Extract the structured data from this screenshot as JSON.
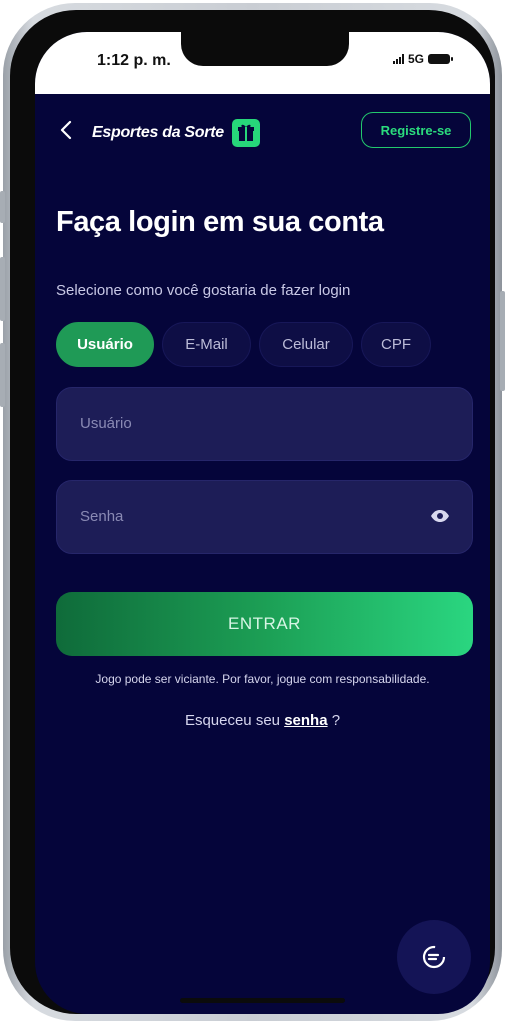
{
  "status_bar": {
    "time": "1:12 p. m.",
    "network": "5G"
  },
  "header": {
    "brand": "Esportes da Sorte",
    "register_label": "Registre-se",
    "back_icon": "chevron-left-icon",
    "gift_icon": "gift-icon"
  },
  "login": {
    "title": "Faça login em sua conta",
    "subtitle": "Selecione como você gostaria de fazer login",
    "tabs": [
      {
        "label": "Usuário",
        "active": true
      },
      {
        "label": "E-Mail",
        "active": false
      },
      {
        "label": "Celular",
        "active": false
      },
      {
        "label": "CPF",
        "active": false
      }
    ],
    "username_placeholder": "Usuário",
    "password_placeholder": "Senha",
    "enter_label": "ENTRAR",
    "disclaimer": "Jogo pode ser viciante. Por favor, jogue com responsabilidade.",
    "forgot_prefix": "Esqueceu seu ",
    "forgot_link": "senha",
    "forgot_suffix": " ?"
  },
  "colors": {
    "background": "#05053a",
    "accent_green": "#27d77a",
    "field_bg": "#1d1d57"
  }
}
